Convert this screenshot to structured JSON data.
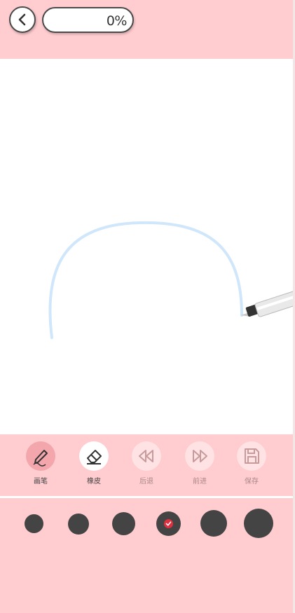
{
  "header": {
    "progress_text": "0%",
    "progress_value": 0
  },
  "toolbar": {
    "items": [
      {
        "label": "画笔",
        "icon": "pencil-icon",
        "state": "active"
      },
      {
        "label": "橡皮",
        "icon": "eraser-icon",
        "state": "enabled"
      },
      {
        "label": "后退",
        "icon": "undo-icon",
        "state": "disabled"
      },
      {
        "label": "前进",
        "icon": "redo-icon",
        "state": "disabled"
      },
      {
        "label": "保存",
        "icon": "save-icon",
        "state": "disabled"
      }
    ]
  },
  "brush_sizes": {
    "count": 6,
    "selected_index": 3
  },
  "colors": {
    "panel_bg": "#ffcccf",
    "stroke": "#cfe6fb",
    "dot": "#444444",
    "check": "#e03040"
  }
}
